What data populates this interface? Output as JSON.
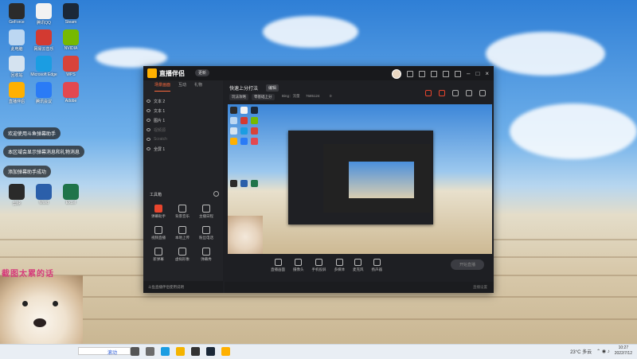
{
  "desktop": {
    "icons": [
      {
        "label": "GeForce",
        "color": "#2b2b2b"
      },
      {
        "label": "腾讯QQ",
        "color": "#f2f2f2"
      },
      {
        "label": "Steam",
        "color": "#1b2838"
      },
      {
        "label": "此电脑",
        "color": "#bcd7f2"
      },
      {
        "label": "网易云音乐",
        "color": "#d33a31"
      },
      {
        "label": "NVIDIA",
        "color": "#76b900"
      },
      {
        "label": "回收站",
        "color": "#d5e3f0"
      },
      {
        "label": "Microsoft Edge",
        "color": "#1b9de2"
      },
      {
        "label": "WPS",
        "color": "#d8433a"
      },
      {
        "label": "直播伴侣",
        "color": "#ffb000"
      },
      {
        "label": "腾讯会议",
        "color": "#2a7bf6"
      },
      {
        "label": "Adobe",
        "color": "#e34850"
      },
      {
        "label": "剪映",
        "color": "#2a2a2a"
      },
      {
        "label": "Word",
        "color": "#2b5faa"
      },
      {
        "label": "Excel",
        "color": "#20744a"
      }
    ]
  },
  "toasts": [
    "欢迎使用斗鱼弹幕助手",
    "本区域会显示弹幕消息和礼物消息",
    "添加弹幕助手成功"
  ],
  "app": {
    "name": "直播伴侣",
    "version": "更新",
    "left_tabs": [
      "场景画面",
      "互动",
      "礼物"
    ],
    "layers": [
      {
        "label": "文本 2",
        "dim": false
      },
      {
        "label": "文本 1",
        "dim": false
      },
      {
        "label": "图片 1",
        "dim": false
      },
      {
        "label": "视频源",
        "dim": true
      },
      {
        "label": "Scratch",
        "dim": true
      },
      {
        "label": "全屏 1",
        "dim": false
      }
    ],
    "tools_header": "工具箱",
    "tools": [
      {
        "label": "弹幕助手",
        "active": true
      },
      {
        "label": "背景音乐",
        "active": false
      },
      {
        "label": "主播日程",
        "active": false
      },
      {
        "label": "视频直播",
        "active": false
      },
      {
        "label": "本地上传",
        "active": false
      },
      {
        "label": "粉丝电话",
        "active": false
      },
      {
        "label": "新弹幕",
        "active": false
      },
      {
        "label": "虚拟形象",
        "active": false
      },
      {
        "label": "弹幕秀",
        "active": false
      }
    ],
    "left_footer": "斗鱼直播伴侣使用说明",
    "room_title": "快速上分打法",
    "edit_tag": "编辑",
    "pills": [
      "玩法攻略",
      "零基础上分"
    ],
    "meta": [
      "Bing：流量",
      "7685124",
      "0"
    ],
    "controls": [
      "直播画面",
      "摄像头",
      "手机投屏",
      "多媒体",
      "麦克风",
      "扬声器"
    ],
    "go_live": "开始直播",
    "status_left": "",
    "status_right": "直播设置"
  },
  "overlay": {
    "watermark": "截图太累的话"
  },
  "taskbar": {
    "scroll_text": "滚动",
    "weather": "23°C 多云",
    "time": "10:27",
    "date": "2022/7/12"
  }
}
